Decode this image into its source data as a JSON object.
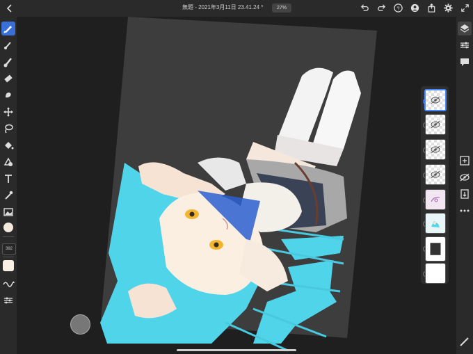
{
  "document": {
    "title": "無題 - 2021年3月11日 23.41.24",
    "modified_marker": "*",
    "zoom": "27%"
  },
  "toolbar_left": {
    "brush_size": "392"
  },
  "colors": {
    "accent": "#3b6fd8",
    "current_color": "#f3e9dc",
    "hair": "#5ad6ec",
    "background": "#1f1f1f"
  },
  "layers_count": 8
}
